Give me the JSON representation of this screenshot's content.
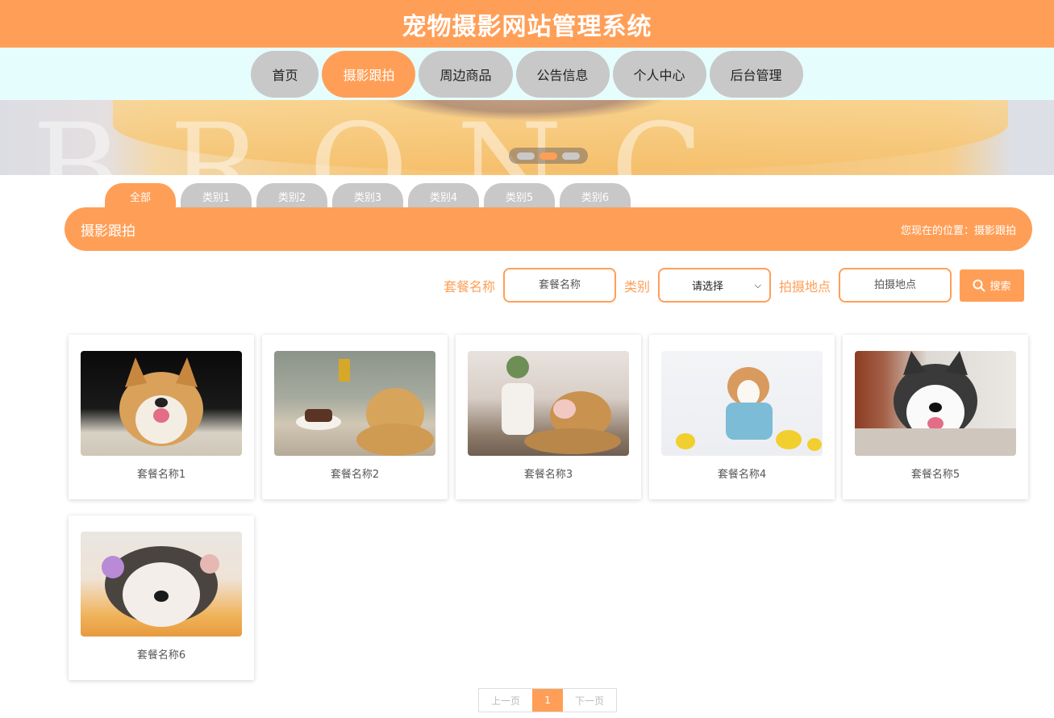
{
  "header": {
    "title": "宠物摄影网站管理系统"
  },
  "nav": {
    "items": [
      {
        "label": "首页",
        "active": false
      },
      {
        "label": "摄影跟拍",
        "active": true
      },
      {
        "label": "周边商品",
        "active": false
      },
      {
        "label": "公告信息",
        "active": false
      },
      {
        "label": "个人中心",
        "active": false
      },
      {
        "label": "后台管理",
        "active": false
      }
    ]
  },
  "banner": {
    "background_text": "BRONC",
    "active_dot": 2,
    "dot_count": 3
  },
  "category_tabs": [
    {
      "label": "全部",
      "active": true
    },
    {
      "label": "类别1",
      "active": false
    },
    {
      "label": "类别2",
      "active": false
    },
    {
      "label": "类别3",
      "active": false
    },
    {
      "label": "类别4",
      "active": false
    },
    {
      "label": "类别5",
      "active": false
    },
    {
      "label": "类别6",
      "active": false
    }
  ],
  "section": {
    "title": "摄影跟拍",
    "breadcrumb": "您现在的位置：摄影跟拍"
  },
  "search": {
    "package_label": "套餐名称",
    "package_placeholder": "套餐名称",
    "category_label": "类别",
    "category_value": "请选择",
    "location_label": "拍摄地点",
    "location_placeholder": "拍摄地点",
    "button_label": "搜索",
    "button_icon": "search-icon"
  },
  "cards": [
    {
      "name": "套餐名称1"
    },
    {
      "name": "套餐名称2"
    },
    {
      "name": "套餐名称3"
    },
    {
      "name": "套餐名称4"
    },
    {
      "name": "套餐名称5"
    },
    {
      "name": "套餐名称6"
    }
  ],
  "pagination": {
    "prev_label": "上一页",
    "current_page": "1",
    "next_label": "下一页"
  },
  "colors": {
    "accent": "#ff9f57",
    "nav_inactive": "#c8c8c8",
    "nav_bar_bg": "#e6fdfe"
  }
}
